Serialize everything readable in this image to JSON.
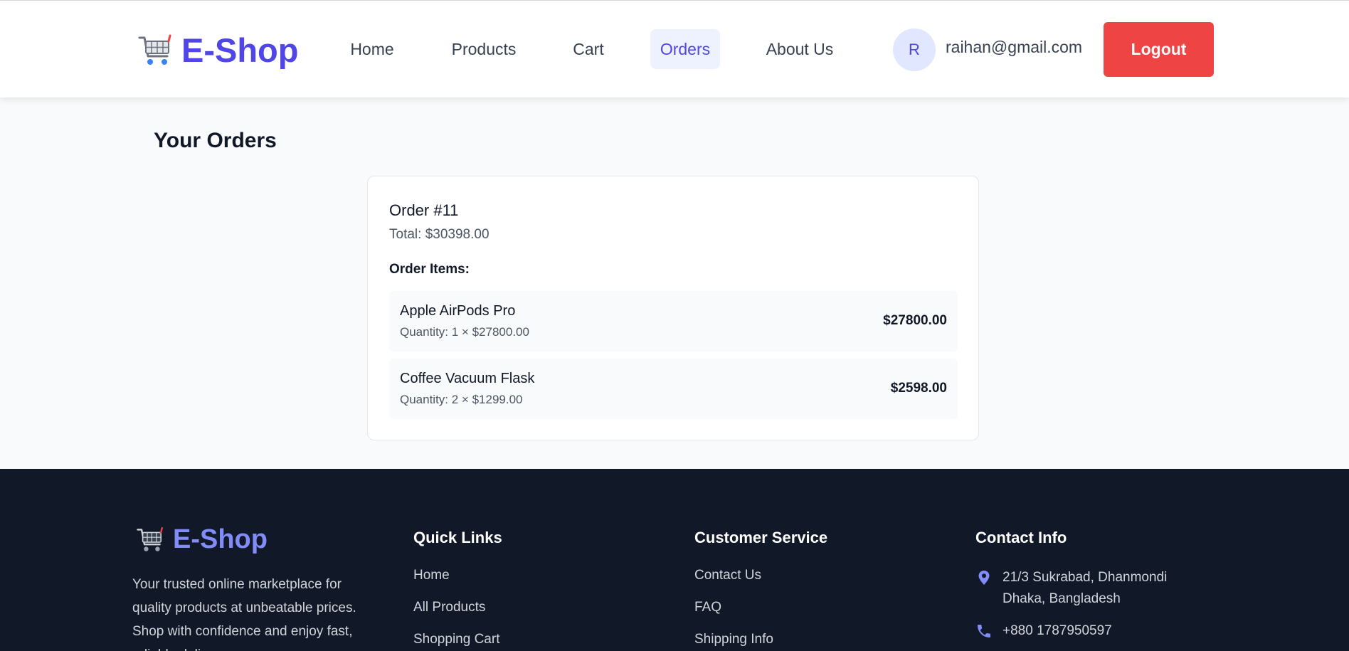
{
  "header": {
    "brand": "E-Shop",
    "nav": [
      {
        "label": "Home",
        "active": false
      },
      {
        "label": "Products",
        "active": false
      },
      {
        "label": "Cart",
        "active": false
      },
      {
        "label": "Orders",
        "active": true
      },
      {
        "label": "About Us",
        "active": false
      }
    ],
    "avatar_initial": "R",
    "user_email": "raihan@gmail.com",
    "logout_label": "Logout"
  },
  "main": {
    "title": "Your Orders",
    "order": {
      "title": "Order #11",
      "total": "Total: $30398.00",
      "items_label": "Order Items:",
      "items": [
        {
          "name": "Apple AirPods Pro",
          "quantity": "Quantity: 1 × $27800.00",
          "price": "$27800.00"
        },
        {
          "name": "Coffee Vacuum Flask",
          "quantity": "Quantity: 2 × $1299.00",
          "price": "$2598.00"
        }
      ]
    }
  },
  "footer": {
    "brand": "E-Shop",
    "description": "Your trusted online marketplace for quality products at unbeatable prices. Shop with confidence and enjoy fast, reliable delivery.",
    "quick_links": {
      "title": "Quick Links",
      "links": [
        "Home",
        "All Products",
        "Shopping Cart"
      ]
    },
    "customer_service": {
      "title": "Customer Service",
      "links": [
        "Contact Us",
        "FAQ",
        "Shipping Info"
      ]
    },
    "contact": {
      "title": "Contact Info",
      "address_line1": "21/3 Sukrabad, Dhanmondi",
      "address_line2": "Dhaka, Bangladesh",
      "phone": "+880 1787950597"
    }
  },
  "icons": {
    "logo": "shopping-cart-icon",
    "address": "map-pin-icon",
    "phone": "phone-icon"
  },
  "colors": {
    "brand": "#4f46e5",
    "logout": "#ef4444",
    "footer_bg": "#111827",
    "footer_accent": "#818cf8"
  }
}
